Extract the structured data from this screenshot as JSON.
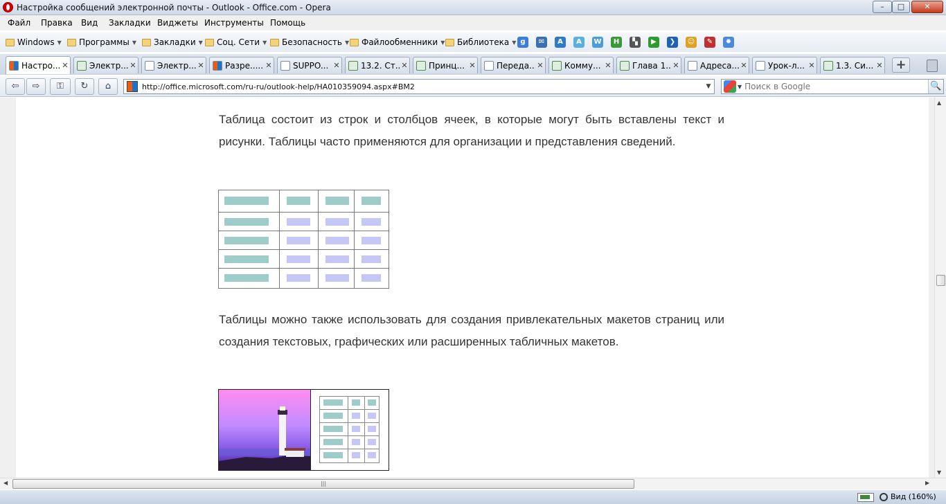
{
  "window": {
    "title": "Настройка сообщений электронной почты - Outlook - Office.com - Opera",
    "controls": {
      "minimize": "–",
      "maximize": "□",
      "close": "✕"
    }
  },
  "menu": [
    "Файл",
    "Правка",
    "Вид",
    "Закладки",
    "Виджеты",
    "Инструменты",
    "Помощь"
  ],
  "bookmark_folders": [
    "Windows",
    "Программы",
    "Закладки",
    "Соц. Сети",
    "Безопасность",
    "Файлообменники",
    "Библиотека"
  ],
  "bookmark_icons": [
    {
      "name": "google-icon",
      "glyph": "g",
      "color": "#3b7ddd"
    },
    {
      "name": "mail-icon",
      "glyph": "✉",
      "color": "#3a6fb0"
    },
    {
      "name": "translate-icon",
      "glyph": "A",
      "color": "#2f79c9"
    },
    {
      "name": "lingvo-icon",
      "glyph": "A",
      "color": "#5ab0e0"
    },
    {
      "name": "word-icon",
      "glyph": "W",
      "color": "#4a9be0"
    },
    {
      "name": "h-icon",
      "glyph": "H",
      "color": "#3a9a3a"
    },
    {
      "name": "flag-icon",
      "glyph": "▚",
      "color": "#555555"
    },
    {
      "name": "play-icon",
      "glyph": "▶",
      "color": "#2e9b2e"
    },
    {
      "name": "arrow-icon",
      "glyph": "❯",
      "color": "#1e62b8"
    },
    {
      "name": "smiley-icon",
      "glyph": "☺",
      "color": "#e0a020"
    },
    {
      "name": "pen-icon",
      "glyph": "✎",
      "color": "#c03030"
    },
    {
      "name": "sun-icon",
      "glyph": "✹",
      "color": "#4a8ad8"
    }
  ],
  "tabs": [
    {
      "label": "Настро...",
      "fav": "ms"
    },
    {
      "label": "Электр...",
      "fav": "doc"
    },
    {
      "label": "Электр...",
      "fav": "plain"
    },
    {
      "label": "Разре.....",
      "fav": "ms"
    },
    {
      "label": "SUPPO...",
      "fav": "plain"
    },
    {
      "label": "13.2. Ст...",
      "fav": "doc"
    },
    {
      "label": "Принц...",
      "fav": "doc"
    },
    {
      "label": "Переда...",
      "fav": "plain"
    },
    {
      "label": "Комму...",
      "fav": "doc"
    },
    {
      "label": "Глава 1...",
      "fav": "doc"
    },
    {
      "label": "Адреса...",
      "fav": "plain"
    },
    {
      "label": "Урок-л...",
      "fav": "plain"
    },
    {
      "label": "1.3. Си...",
      "fav": "doc"
    }
  ],
  "tab_close_glyph": "✕",
  "new_tab_glyph": "+",
  "nav": {
    "back": "⇦",
    "forward": "⇨",
    "key": "⚿",
    "reload": "↻",
    "home": "⌂"
  },
  "address": {
    "url": "http://office.microsoft.com/ru-ru/outlook-help/HA010359094.aspx#BM2",
    "dropdown": "▼"
  },
  "search": {
    "placeholder": "Поиск в Google",
    "button": "🔍"
  },
  "content": {
    "paragraph1": "Таблица состоит из строк и столбцов ячеек, в которые могут быть вставлены текст и рисунки. Таблицы часто применяются для организации и представления сведений.",
    "paragraph2": "Таблицы можно также использовать для создания привлекательных макетов страниц или создания текстовых, графических или расширенных табличных макетов."
  },
  "colors": {
    "header_cell": "#9dccc9",
    "body_cell": "#c7c7f7",
    "first_col_cell": "#9dccc9"
  },
  "hscroll_grip": "|||",
  "status": {
    "zoom": "Вид (160%)"
  }
}
